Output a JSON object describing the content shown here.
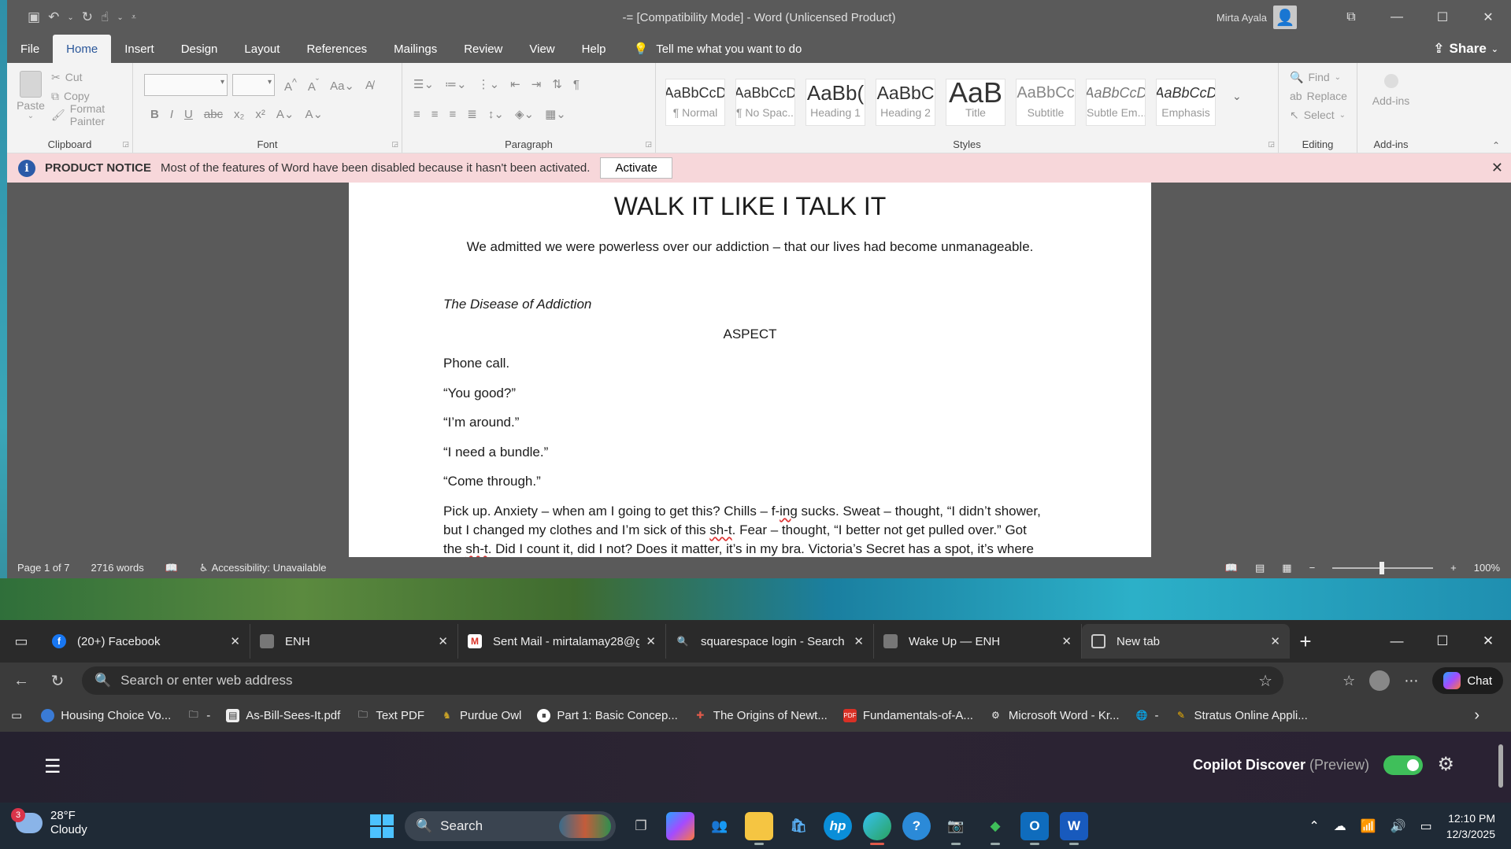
{
  "word": {
    "title": "-= [Compatibility Mode]  -  Word (Unlicensed Product)",
    "user_name": "Mirta Ayala",
    "menu": [
      "File",
      "Home",
      "Insert",
      "Design",
      "Layout",
      "References",
      "Mailings",
      "Review",
      "View",
      "Help"
    ],
    "tell_me": "Tell me what you want to do",
    "share": "Share",
    "ribbon": {
      "clipboard": {
        "paste": "Paste",
        "cut": "Cut",
        "copy": "Copy",
        "format_painter": "Format Painter",
        "label": "Clipboard"
      },
      "font": {
        "label": "Font"
      },
      "paragraph": {
        "label": "Paragraph"
      },
      "styles": {
        "label": "Styles",
        "items": [
          {
            "sample": "AaBbCcD",
            "name": "¶ Normal"
          },
          {
            "sample": "AaBbCcD",
            "name": "¶ No Spac..."
          },
          {
            "sample": "AaBb(",
            "name": "Heading 1"
          },
          {
            "sample": "AaBbC",
            "name": "Heading 2"
          },
          {
            "sample": "AaB",
            "name": "Title"
          },
          {
            "sample": "AaBbCc",
            "name": "Subtitle"
          },
          {
            "sample": "AaBbCcD",
            "name": "Subtle Em..."
          },
          {
            "sample": "AaBbCcD",
            "name": "Emphasis"
          }
        ]
      },
      "editing": {
        "find": "Find",
        "replace": "Replace",
        "select": "Select",
        "label": "Editing"
      },
      "addins": {
        "button": "Add-ins",
        "label": "Add-ins"
      }
    },
    "notice": {
      "title": "PRODUCT NOTICE",
      "message": "Most of the features of Word have been disabled because it hasn't been activated.",
      "button": "Activate"
    },
    "document": {
      "title": "WALK IT LIKE I TALK IT",
      "step": "We admitted we were powerless over our addiction – that our lives had become unmanageable.",
      "section": "The Disease of Addiction",
      "heading": "ASPECT",
      "lines": [
        "Phone call.",
        "“You good?”",
        "“I’m around.”",
        "“I need a bundle.”",
        "“Come through.”"
      ],
      "para_1a": "Pick up. Anxiety – when am I going to get this? Chills – f-",
      "para_1_sq1": "ing",
      "para_1b": " sucks. Sweat – thought, “I didn’t shower,",
      "para_2a": "but I changed my clothes and I’m sick of this ",
      "para_2_sq": "sh-t",
      "para_2b": ". Fear – thought, “I better not get pulled over.” Got",
      "para_3a": "the ",
      "para_3_sq": "sh-t",
      "para_3b": ". Did I count it, did I not? Does it matter, it’s in my bra. Victoria’s Secret has a spot, it’s where"
    },
    "status": {
      "page": "Page 1 of 7",
      "words": "2716 words",
      "accessibility": "Accessibility: Unavailable",
      "zoom": "100%"
    }
  },
  "browser": {
    "tabs": [
      {
        "title": "(20+) Facebook",
        "icon": "facebook-icon"
      },
      {
        "title": "ENH",
        "icon": "page-icon"
      },
      {
        "title": "Sent Mail - mirtalamay28@g",
        "icon": "gmail-icon"
      },
      {
        "title": "squarespace login - Search",
        "icon": "search-icon"
      },
      {
        "title": "Wake Up — ENH",
        "icon": "page-icon"
      },
      {
        "title": "New tab",
        "icon": "newtab-icon"
      }
    ],
    "address_placeholder": "Search or enter web address",
    "chat": "Chat",
    "bookmarks": [
      "Housing Choice Vo...",
      "-",
      "As-Bill-Sees-It.pdf",
      "Text PDF",
      "Purdue Owl",
      "Part 1: Basic Concep...",
      "The Origins of Newt...",
      "Fundamentals-of-A...",
      "Microsoft Word - Kr...",
      "-",
      "Stratus Online Appli..."
    ],
    "copilot_discover": "Copilot Discover",
    "preview": "(Preview)"
  },
  "taskbar": {
    "badge": "3",
    "temperature": "28°F",
    "condition": "Cloudy",
    "search": "Search",
    "time": "12:10 PM",
    "date": "12/3/2025"
  },
  "colors": {
    "word_chrome": "#5a5a5a",
    "ribbon": "#f3f3f3",
    "notice_bg": "#f7d7da",
    "accent": "#2b579a",
    "toggle_on": "#3fbf5a"
  }
}
